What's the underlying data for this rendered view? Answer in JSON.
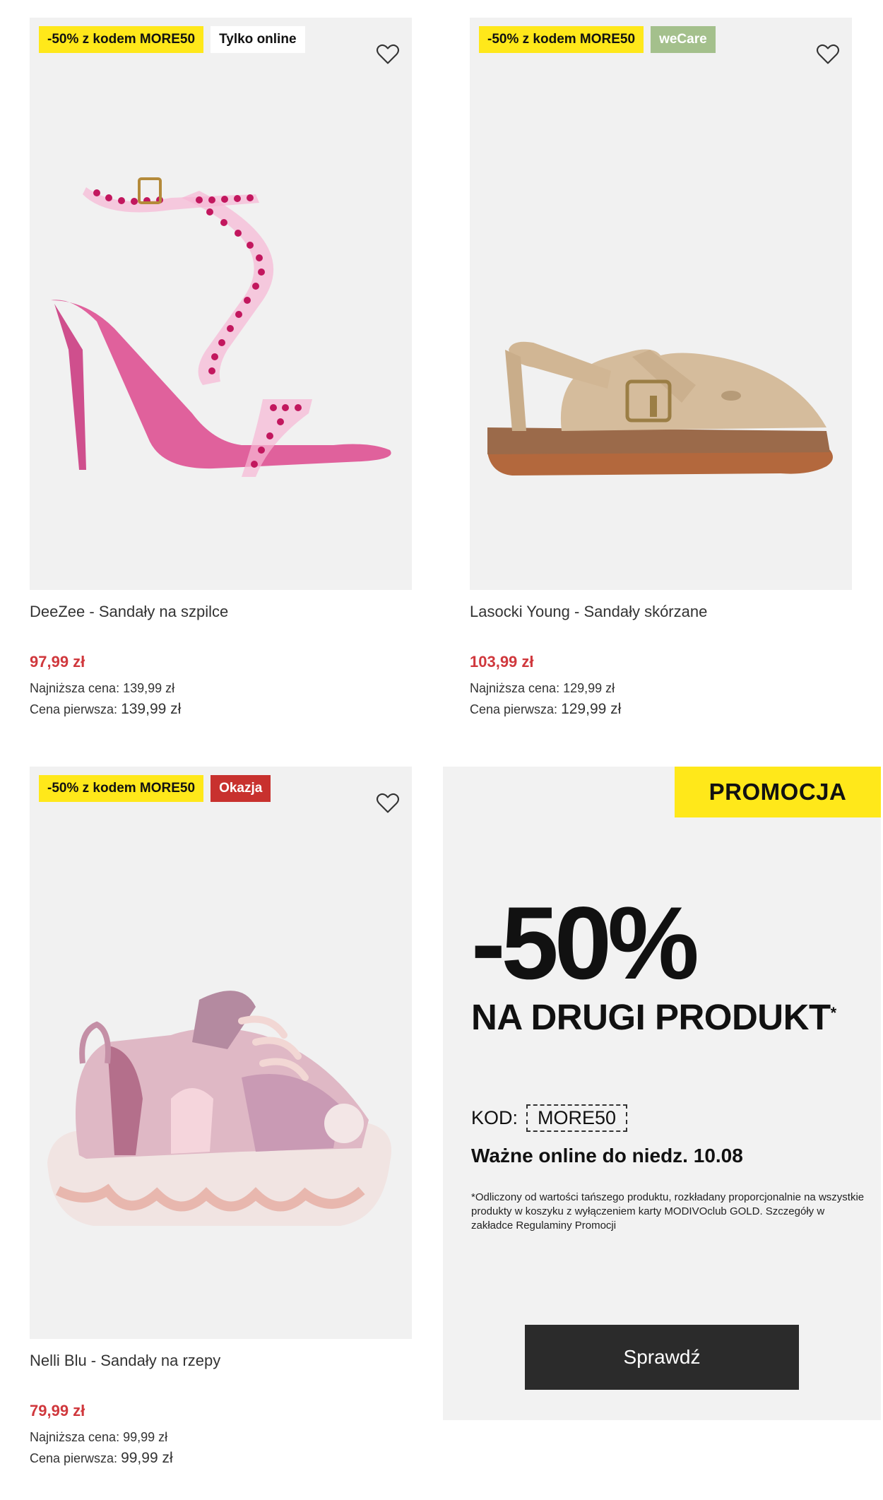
{
  "products": [
    {
      "badges": [
        "-50% z kodem MORE50",
        "Tylko online"
      ],
      "title": "DeeZee - Sandały na szpilce",
      "price": "97,99 zł",
      "lowest_label": "Najniższa cena:",
      "lowest_value": "139,99 zł",
      "first_label": "Cena pierwsza:",
      "first_value": "139,99 zł"
    },
    {
      "badges": [
        "-50% z kodem MORE50",
        "weCare"
      ],
      "title": "Lasocki Young - Sandały skórzane",
      "price": "103,99 zł",
      "lowest_label": "Najniższa cena:",
      "lowest_value": "129,99 zł",
      "first_label": "Cena pierwsza:",
      "first_value": "129,99 zł"
    },
    {
      "badges": [
        "-50% z kodem MORE50",
        "Okazja"
      ],
      "title": "Nelli Blu - Sandały na rzepy",
      "price": "79,99 zł",
      "lowest_label": "Najniższa cena:",
      "lowest_value": "99,99 zł",
      "first_label": "Cena pierwsza:",
      "first_value": "99,99 zł"
    }
  ],
  "promo": {
    "tag": "PROMOCJA",
    "discount": "-50%",
    "headline": "NA DRUGI PRODUKT",
    "headline_mark": "*",
    "code_label": "KOD:",
    "code": "MORE50",
    "valid": "Ważne online do niedz. 10.08",
    "fine_print": "*Odliczony od wartości tańszego produktu, rozkładany proporcjonalnie na wszystkie produkty w koszyku z wyłączeniem karty MODIVOclub GOLD. Szczegóły w zakładce Regulaminy Promocji",
    "cta": "Sprawdź"
  },
  "colors": {
    "price_red": "#d0383d",
    "promo_yellow": "#ffe81a",
    "wecare_green": "#a4c08c",
    "okazja_red": "#c8312e",
    "cta_dark": "#2b2b2b"
  }
}
